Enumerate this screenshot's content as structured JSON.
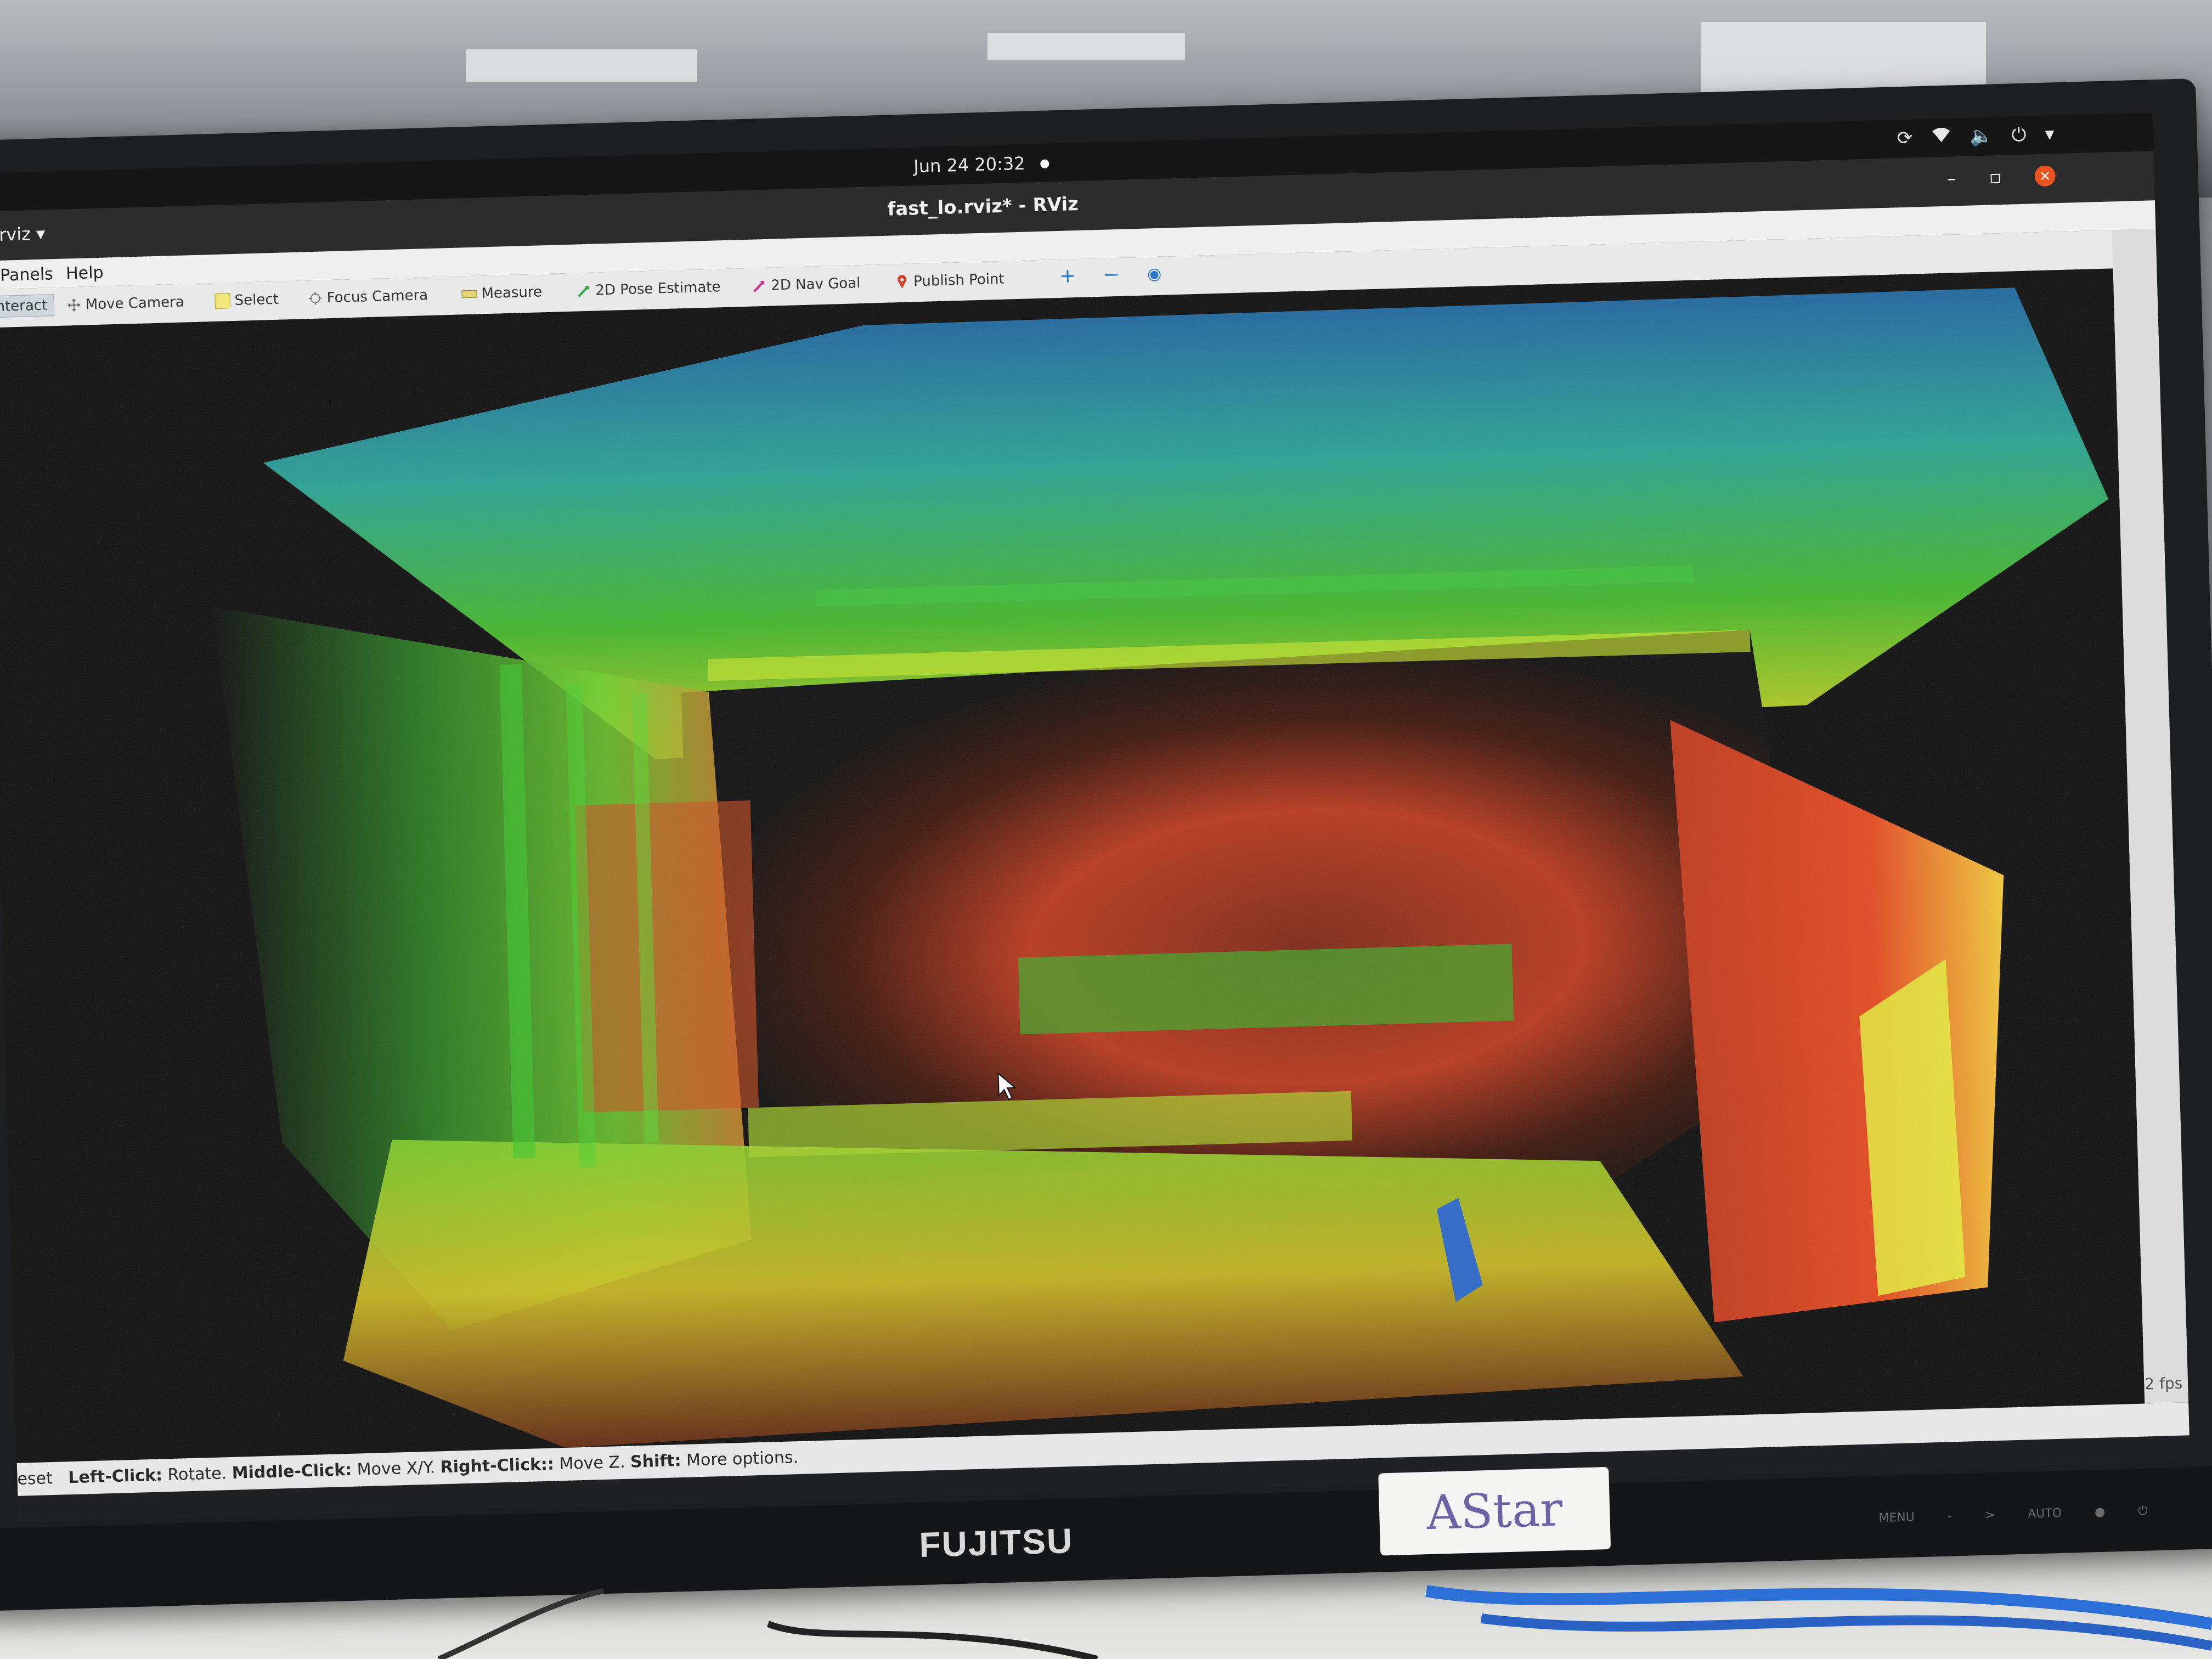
{
  "topbar": {
    "clock": "Jun 24  20:32",
    "tray_icons": [
      "steam-icon",
      "wifi-icon",
      "volume-icon",
      "power-icon",
      "chevron-down-icon"
    ]
  },
  "window": {
    "app_menu": "rviz ▾",
    "title": "fast_lo.rviz* - RViz",
    "controls": {
      "minimize": "–",
      "restore": "▫",
      "close": "×"
    }
  },
  "menubar": {
    "panels": "Panels",
    "help": "Help"
  },
  "toolbar": {
    "interact": "Interact",
    "move_camera": "Move Camera",
    "select": "Select",
    "focus_camera": "Focus Camera",
    "measure": "Measure",
    "pose_estimate": "2D Pose Estimate",
    "nav_goal": "2D Nav Goal",
    "publish_point": "Publish Point",
    "add": "+",
    "remove": "−",
    "camera_view": "◉"
  },
  "viewport": {
    "fps": "2 fps"
  },
  "statusbar": {
    "reset": "eset",
    "left_click_key": "Left-Click:",
    "left_click_val": "Rotate.",
    "middle_click_key": "Middle-Click:",
    "middle_click_val": "Move X/Y.",
    "right_click_key": "Right-Click::",
    "right_click_val": "Move Z.",
    "shift_key": "Shift:",
    "shift_val": "More options."
  },
  "monitor": {
    "brand": "FUJITSU",
    "sticker": "AStar",
    "buttons": [
      "MENU",
      "-",
      ">",
      "AUTO",
      "●",
      "⏻"
    ]
  },
  "colors": {
    "pointcloud_red": "#d8391c",
    "pointcloud_orange": "#e8861d",
    "pointcloud_yellow": "#d8e323",
    "pointcloud_green": "#3fc92a",
    "pointcloud_cyan": "#27b3b8",
    "pointcloud_blue": "#2a66c9",
    "close_button": "#e95420"
  }
}
